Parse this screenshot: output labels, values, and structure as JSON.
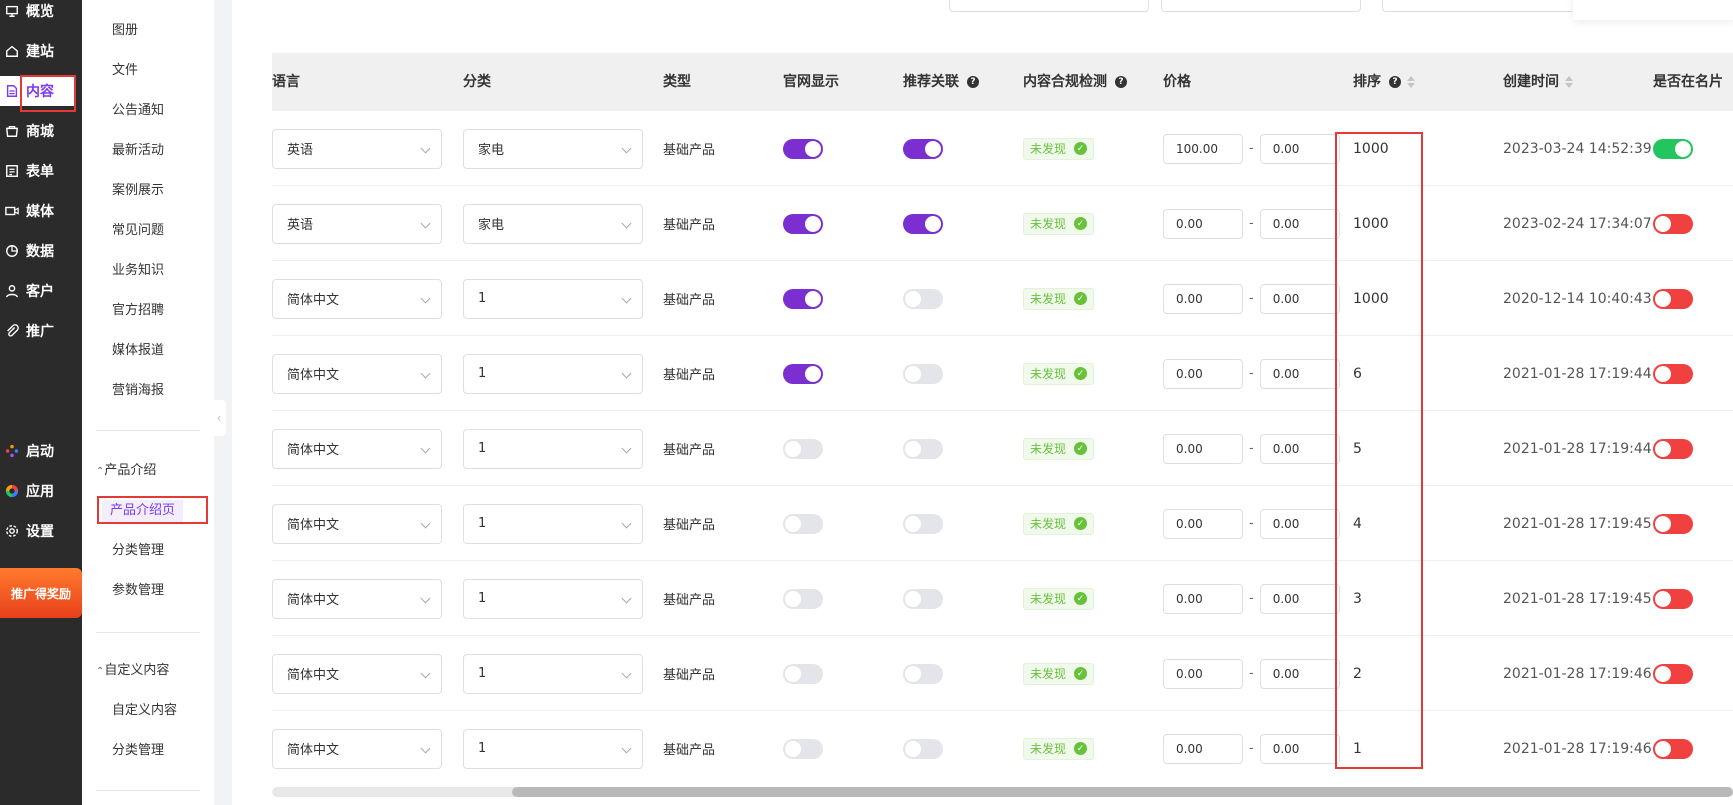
{
  "nav": {
    "items": [
      {
        "label": "概览",
        "icon": "overview-icon"
      },
      {
        "label": "建站",
        "icon": "home-icon"
      },
      {
        "label": "内容",
        "icon": "document-icon"
      },
      {
        "label": "商城",
        "icon": "shop-icon"
      },
      {
        "label": "表单",
        "icon": "form-icon"
      },
      {
        "label": "媒体",
        "icon": "video-icon"
      },
      {
        "label": "数据",
        "icon": "chart-pie-icon"
      },
      {
        "label": "客户",
        "icon": "user-icon"
      },
      {
        "label": "推广",
        "icon": "paperclip-icon"
      }
    ],
    "bottom": [
      {
        "label": "启动",
        "icon": "launch-dots-icon"
      },
      {
        "label": "应用",
        "icon": "apps-icon"
      },
      {
        "label": "设置",
        "icon": "gear-icon"
      }
    ],
    "promo_label": "推广得奖励",
    "active_color": "#7c3aed"
  },
  "submenu": {
    "items": [
      "图册",
      "文件",
      "公告通知",
      "最新活动",
      "案例展示",
      "常见问题",
      "业务知识",
      "官方招聘",
      "媒体报道",
      "营销海报"
    ],
    "group1": "产品介绍",
    "group1_items": [
      "产品介绍页",
      "分类管理",
      "参数管理"
    ],
    "group2": "自定义内容",
    "group2_items": [
      "自定义内容",
      "分类管理"
    ]
  },
  "table": {
    "headers": {
      "lang": "语言",
      "category": "分类",
      "type": "类型",
      "site_show": "官网显示",
      "recommend": "推荐关联",
      "compliance": "内容合规检测",
      "price": "价格",
      "sort": "排序",
      "created": "创建时间",
      "in_card": "是否在名片"
    },
    "rows": [
      {
        "lang": "英语",
        "category": "家电",
        "type": "基础产品",
        "site_show": "on",
        "recommend": "on",
        "badge": "未发现",
        "price_min": "100.00",
        "price_max": "0.00",
        "sort": "1000",
        "created": "2023-03-24 14:52:39",
        "in_card": "green"
      },
      {
        "lang": "英语",
        "category": "家电",
        "type": "基础产品",
        "site_show": "on",
        "recommend": "on",
        "badge": "未发现",
        "price_min": "0.00",
        "price_max": "0.00",
        "sort": "1000",
        "created": "2023-02-24 17:34:07",
        "in_card": "red"
      },
      {
        "lang": "简体中文",
        "category": "1",
        "type": "基础产品",
        "site_show": "on",
        "recommend": "off",
        "badge": "未发现",
        "price_min": "0.00",
        "price_max": "0.00",
        "sort": "1000",
        "created": "2020-12-14 10:40:43",
        "in_card": "red"
      },
      {
        "lang": "简体中文",
        "category": "1",
        "type": "基础产品",
        "site_show": "on",
        "recommend": "off",
        "badge": "未发现",
        "price_min": "0.00",
        "price_max": "0.00",
        "sort": "6",
        "created": "2021-01-28 17:19:44",
        "in_card": "red"
      },
      {
        "lang": "简体中文",
        "category": "1",
        "type": "基础产品",
        "site_show": "off",
        "recommend": "off",
        "badge": "未发现",
        "price_min": "0.00",
        "price_max": "0.00",
        "sort": "5",
        "created": "2021-01-28 17:19:44",
        "in_card": "red"
      },
      {
        "lang": "简体中文",
        "category": "1",
        "type": "基础产品",
        "site_show": "off",
        "recommend": "off",
        "badge": "未发现",
        "price_min": "0.00",
        "price_max": "0.00",
        "sort": "4",
        "created": "2021-01-28 17:19:45",
        "in_card": "red"
      },
      {
        "lang": "简体中文",
        "category": "1",
        "type": "基础产品",
        "site_show": "off",
        "recommend": "off",
        "badge": "未发现",
        "price_min": "0.00",
        "price_max": "0.00",
        "sort": "3",
        "created": "2021-01-28 17:19:45",
        "in_card": "red"
      },
      {
        "lang": "简体中文",
        "category": "1",
        "type": "基础产品",
        "site_show": "off",
        "recommend": "off",
        "badge": "未发现",
        "price_min": "0.00",
        "price_max": "0.00",
        "sort": "2",
        "created": "2021-01-28 17:19:46",
        "in_card": "red"
      },
      {
        "lang": "简体中文",
        "category": "1",
        "type": "基础产品",
        "site_show": "off",
        "recommend": "off",
        "badge": "未发现",
        "price_min": "0.00",
        "price_max": "0.00",
        "sort": "1",
        "created": "2021-01-28 17:19:46",
        "in_card": "red"
      }
    ]
  },
  "colors": {
    "toggle_on": "#7b2fd0",
    "toggle_off": "#e4e5ea",
    "status_green": "#22c55e",
    "status_red": "#f04040",
    "highlight_box": "#e53935"
  }
}
